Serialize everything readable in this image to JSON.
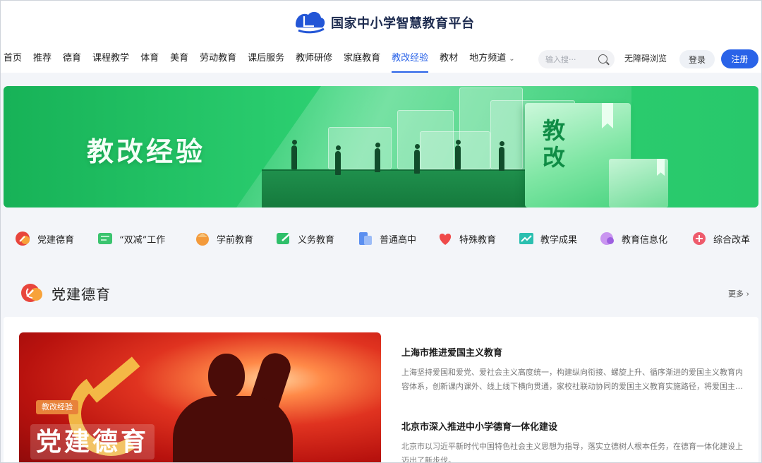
{
  "header": {
    "logo_title": "国家中小学智慧教育平台"
  },
  "nav": {
    "items": [
      "首页",
      "推荐",
      "德育",
      "课程教学",
      "体育",
      "美育",
      "劳动教育",
      "课后服务",
      "教师研修",
      "家庭教育",
      "教改经验",
      "教材",
      "地方频道"
    ],
    "active": "教改经验"
  },
  "search": {
    "placeholder": "输入搜···"
  },
  "accessibility_label": "无障碍浏览",
  "login_label": "登录",
  "register_label": "注册",
  "banner": {
    "title": "教改经验",
    "book_text_1": "教",
    "book_text_2": "改"
  },
  "categories": [
    {
      "label": "党建德育",
      "icon": "party-emblem-icon",
      "color": "#e8453c"
    },
    {
      "label": "“双减”工作",
      "icon": "double-reduction-icon",
      "color": "#3bc46f"
    },
    {
      "label": "学前教育",
      "icon": "preschool-icon",
      "color": "#f39a3b"
    },
    {
      "label": "义务教育",
      "icon": "compulsory-education-icon",
      "color": "#2fbf6a"
    },
    {
      "label": "普通高中",
      "icon": "high-school-icon",
      "color": "#5b8ff0"
    },
    {
      "label": "特殊教育",
      "icon": "special-education-icon",
      "color": "#ef4a4a"
    },
    {
      "label": "教学成果",
      "icon": "teaching-results-icon",
      "color": "#2bbfb0"
    },
    {
      "label": "教育信息化",
      "icon": "education-informatization-icon",
      "color": "#b478e8"
    },
    {
      "label": "综合改革",
      "icon": "comprehensive-reform-icon",
      "color": "#ee5b6c"
    }
  ],
  "section": {
    "title": "党建德育",
    "more_label": "更多 ›"
  },
  "feature": {
    "tag": "教改经验",
    "caption": "党建德育"
  },
  "articles": [
    {
      "title": "上海市推进爱国主义教育",
      "desc": "上海坚持爱国和爱党、爱社会主义高度统一，构建纵向衔接、螺旋上升、循序渐进的爱国主义教育内容体系，创新课内课外、线上线下横向贯通，家校社联动协同的爱国主义教育实施路径，将爱国主…"
    },
    {
      "title": "北京市深入推进中小学德育一体化建设",
      "desc": "北京市以习近平新时代中国特色社会主义思想为指导，落实立德树人根本任务，在德育一体化建设上迈出了新步伐。"
    }
  ]
}
